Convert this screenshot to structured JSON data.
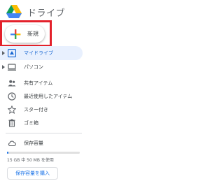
{
  "app": {
    "title": "ドライブ"
  },
  "new_button": {
    "label": "新規"
  },
  "nav": {
    "items": [
      {
        "label": "マイドライブ",
        "icon": "my-drive-icon",
        "active": true,
        "expandable": true
      },
      {
        "label": "パソコン",
        "icon": "computer-icon",
        "active": false,
        "expandable": true
      },
      {
        "label": "共有アイテム",
        "icon": "shared-people-icon",
        "active": false,
        "expandable": false
      },
      {
        "label": "最近使用したアイテム",
        "icon": "clock-icon",
        "active": false,
        "expandable": false
      },
      {
        "label": "スター付き",
        "icon": "star-icon",
        "active": false,
        "expandable": false
      },
      {
        "label": "ゴミ箱",
        "icon": "trash-icon",
        "active": false,
        "expandable": false
      }
    ]
  },
  "storage": {
    "label": "保存容量",
    "icon": "cloud-icon",
    "usage_text": "15 GB 中 50 MB を使用",
    "used_fraction": 0.003,
    "buy_label": "保存容量を購入"
  },
  "colors": {
    "accent": "#1a73e8",
    "active_bg": "#e8f0fe",
    "highlight_border": "#e3212b"
  }
}
